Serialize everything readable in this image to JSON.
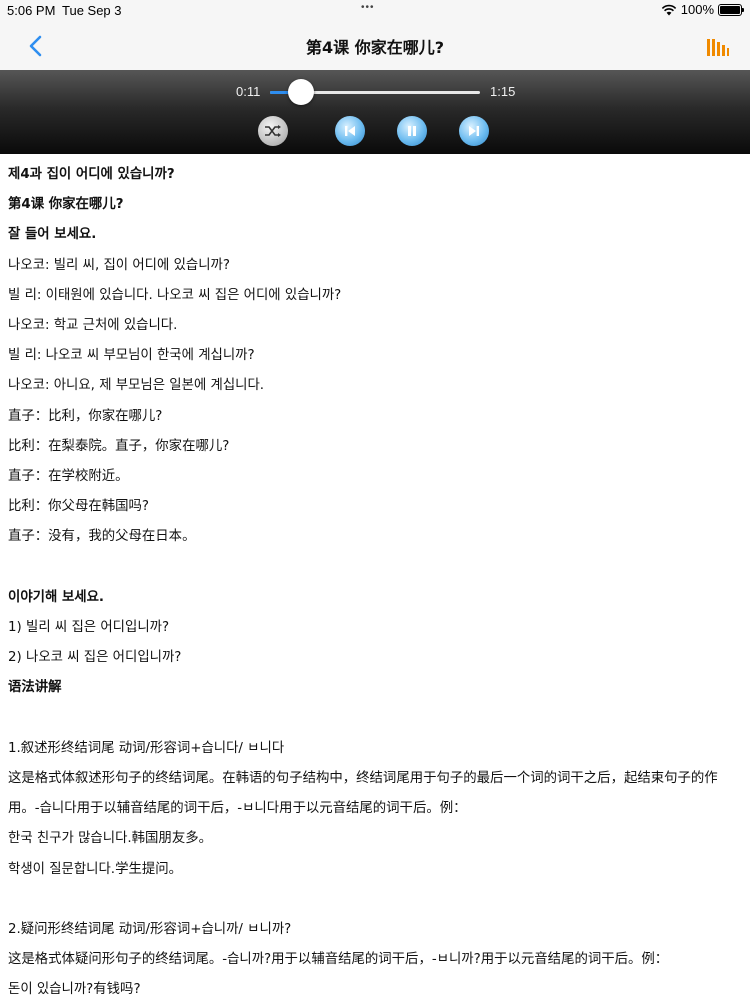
{
  "status_bar": {
    "time": "5:06 PM",
    "date": "Tue Sep 3",
    "dots": "•••",
    "battery": "100%"
  },
  "nav": {
    "back_icon": "chevron-left-icon",
    "title": "第4课 你家在哪儿?",
    "menu_icon": "bar-chart-icon",
    "accent": "#2e8ef0",
    "menu_color": "#f08a00"
  },
  "player": {
    "current_time": "0:11",
    "total_time": "1:15",
    "progress": 0.147,
    "buttons": [
      "shuffle-icon",
      "previous-icon",
      "pause-icon",
      "next-icon"
    ]
  },
  "content": {
    "lines": [
      {
        "text": "제4과 집이 어디에 있습니까?",
        "bold": true
      },
      {
        "text": "第4课 你家在哪儿?",
        "bold": true
      },
      {
        "text": "잘 들어 보세요.",
        "bold": true
      },
      {
        "text": "나오코: 빌리 씨, 집이 어디에 있습니까?",
        "bold": false
      },
      {
        "text": "빌 리: 이태원에 있습니다. 나오코 씨 집은 어디에 있습니까?",
        "bold": false
      },
      {
        "text": "나오코: 학교 근처에 있습니다.",
        "bold": false
      },
      {
        "text": "빌 리: 나오코 씨 부모님이 한국에 계십니까?",
        "bold": false
      },
      {
        "text": "나오코: 아니요, 제 부모님은 일본에 계십니다.",
        "bold": false
      },
      {
        "text": "直子：比利，你家在哪儿?",
        "bold": false
      },
      {
        "text": "比利：在梨泰院。直子，你家在哪儿?",
        "bold": false
      },
      {
        "text": "直子：在学校附近。",
        "bold": false
      },
      {
        "text": "比利：你父母在韩国吗?",
        "bold": false
      },
      {
        "text": "直子：没有，我的父母在日本。",
        "bold": false
      },
      {
        "text": "",
        "bold": false
      },
      {
        "text": "이야기해 보세요.",
        "bold": true
      },
      {
        "text": "1) 빌리 씨 집은 어디입니까?",
        "bold": false
      },
      {
        "text": "2) 나오코 씨 집은 어디입니까?",
        "bold": false
      },
      {
        "text": "语法讲解",
        "bold": true
      },
      {
        "text": "",
        "bold": false
      },
      {
        "text": "1.叙述形终结词尾 动词/形容词+습니다/ ㅂ니다",
        "bold": false
      }
    ],
    "paragraph_1": "这是格式体叙述形句子的终结词尾。在韩语的句子结构中，终结词尾用于句子的最后一个词的词干之后，起结束句子的作用。-습니다用于以辅音结尾的词干后，-ㅂ니다用于以元音结尾的词干后。例：",
    "lines_2": [
      {
        "text": "한국 친구가 많습니다.韩国朋友多。",
        "bold": false
      },
      {
        "text": "학생이 질문합니다.学生提问。",
        "bold": false
      },
      {
        "text": "",
        "bold": false
      },
      {
        "text": "2.疑问形终结词尾 动词/形容词+습니까/ ㅂ니까?",
        "bold": false
      },
      {
        "text": "这是格式体疑问形句子的终结词尾。-습니까?用于以辅音结尾的词干后，-ㅂ니까?用于以元音结尾的词干后。例：",
        "bold": false
      },
      {
        "text": "돈이 있습니까?有钱吗?",
        "bold": false
      }
    ]
  }
}
